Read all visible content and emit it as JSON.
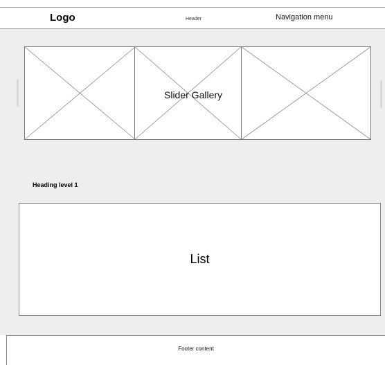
{
  "header": {
    "logo": "Logo",
    "label": "Header",
    "nav": "Navigation menu"
  },
  "gallery": {
    "label": "Slider Gallery"
  },
  "content": {
    "heading": "Heading level 1",
    "list_label": "List"
  },
  "footer": {
    "label": "Footer content"
  }
}
